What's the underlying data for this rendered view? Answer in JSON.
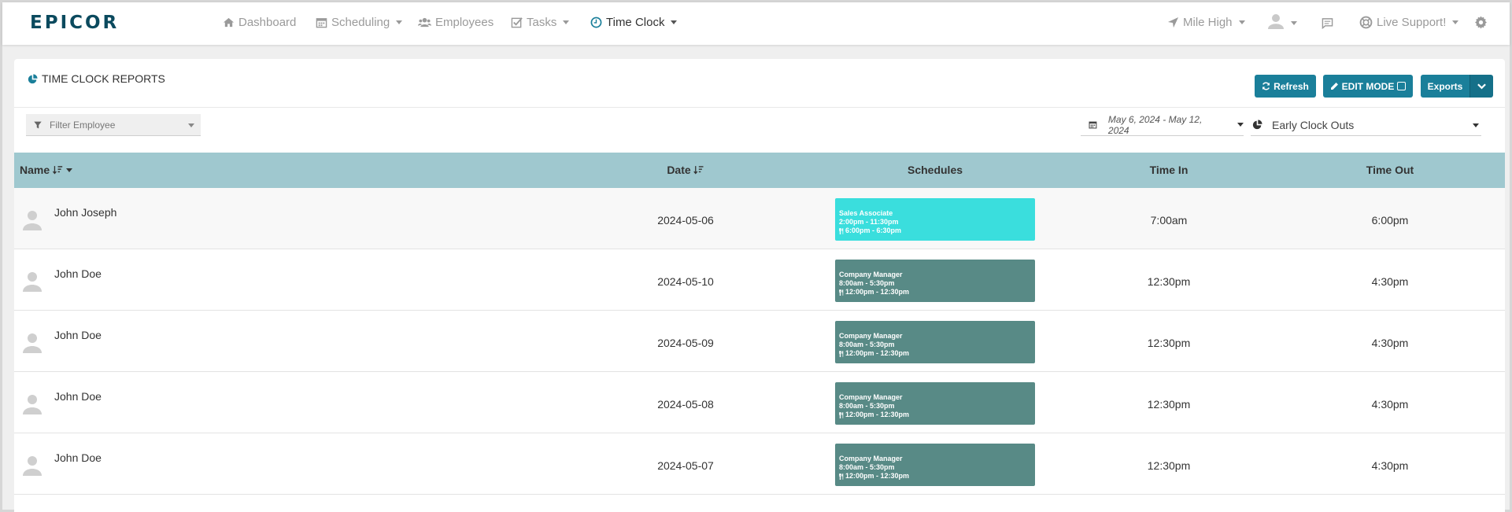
{
  "app": {
    "logo_text": "EPICOR",
    "brand_color": "#0b4a5e",
    "accent_color": "#1a7f9a"
  },
  "nav": {
    "items": [
      {
        "label": "Dashboard",
        "icon": "home-icon"
      },
      {
        "label": "Scheduling",
        "icon": "calendar-icon",
        "dropdown": true
      },
      {
        "label": "Employees",
        "icon": "users-icon"
      },
      {
        "label": "Tasks",
        "icon": "checkbox-icon",
        "dropdown": true
      },
      {
        "label": "Time Clock",
        "icon": "clock-icon",
        "dropdown": true,
        "active": true
      }
    ],
    "location": "Mile High",
    "support": "Live Support!"
  },
  "page": {
    "title": "TIME CLOCK REPORTS",
    "refresh_label": "Refresh",
    "edit_mode_label": "EDIT MODE",
    "exports_label": "Exports",
    "filter_placeholder": "Filter Employee",
    "date_range": "May 6, 2024 - May 12, 2024",
    "report_type": "Early Clock Outs"
  },
  "table": {
    "headers": {
      "name": "Name",
      "date": "Date",
      "schedules": "Schedules",
      "time_in": "Time In",
      "time_out": "Time Out"
    },
    "rows": [
      {
        "name": "John Joseph",
        "date": "2024-05-06",
        "sched_role": "Sales Associate",
        "sched_time": "2:00pm - 11:30pm",
        "sched_break": "6:00pm - 6:30pm",
        "sched_color": "#3adedd",
        "time_in": "7:00am",
        "time_out": "6:00pm"
      },
      {
        "name": "John Doe",
        "date": "2024-05-10",
        "sched_role": "Company Manager",
        "sched_time": "8:00am - 5:30pm",
        "sched_break": "12:00pm - 12:30pm",
        "sched_color": "#588a86",
        "time_in": "12:30pm",
        "time_out": "4:30pm"
      },
      {
        "name": "John Doe",
        "date": "2024-05-09",
        "sched_role": "Company Manager",
        "sched_time": "8:00am - 5:30pm",
        "sched_break": "12:00pm - 12:30pm",
        "sched_color": "#588a86",
        "time_in": "12:30pm",
        "time_out": "4:30pm"
      },
      {
        "name": "John Doe",
        "date": "2024-05-08",
        "sched_role": "Company Manager",
        "sched_time": "8:00am - 5:30pm",
        "sched_break": "12:00pm - 12:30pm",
        "sched_color": "#588a86",
        "time_in": "12:30pm",
        "time_out": "4:30pm"
      },
      {
        "name": "John Doe",
        "date": "2024-05-07",
        "sched_role": "Company Manager",
        "sched_time": "8:00am - 5:30pm",
        "sched_break": "12:00pm - 12:30pm",
        "sched_color": "#588a86",
        "time_in": "12:30pm",
        "time_out": "4:30pm"
      }
    ]
  }
}
